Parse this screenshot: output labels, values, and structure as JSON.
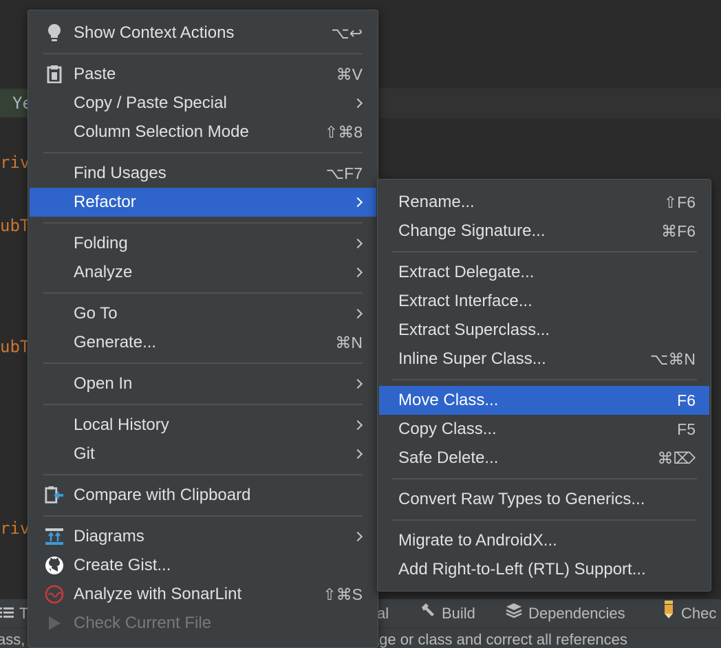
{
  "editor": {
    "code_fragments": [
      "Ye",
      "riv",
      "ubT",
      "ubT",
      "riv"
    ]
  },
  "toolbar": {
    "todo_fragment": "T",
    "terminal_fragment": "al",
    "build": "Build",
    "dependencies": "Dependencies",
    "check": "Chec"
  },
  "status": {
    "message": "ass, method, package or static member to another package or class and correct all references"
  },
  "context_menu": {
    "items": [
      {
        "label": "Show Context Actions",
        "shortcut": "⌥↩",
        "icon": "lightbulb-icon"
      },
      {
        "label": "Paste",
        "shortcut": "⌘V",
        "icon": "clipboard-icon"
      },
      {
        "label": "Copy / Paste Special",
        "submenu": true
      },
      {
        "label": "Column Selection Mode",
        "shortcut": "⇧⌘8"
      },
      {
        "label": "Find Usages",
        "shortcut": "⌥F7"
      },
      {
        "label": "Refactor",
        "submenu": true,
        "selected": true
      },
      {
        "label": "Folding",
        "submenu": true
      },
      {
        "label": "Analyze",
        "submenu": true
      },
      {
        "label": "Go To",
        "submenu": true
      },
      {
        "label": "Generate...",
        "shortcut": "⌘N"
      },
      {
        "label": "Open In",
        "submenu": true
      },
      {
        "label": "Local History",
        "submenu": true
      },
      {
        "label": "Git",
        "submenu": true
      },
      {
        "label": "Compare with Clipboard",
        "icon": "compare-clipboard-icon"
      },
      {
        "label": "Diagrams",
        "submenu": true,
        "icon": "diagram-icon"
      },
      {
        "label": "Create Gist...",
        "icon": "github-icon"
      },
      {
        "label": "Analyze with SonarLint",
        "shortcut": "⇧⌘S",
        "icon": "sonarlint-icon"
      },
      {
        "label": "Check Current File",
        "disabled": true,
        "icon": "play-icon"
      }
    ]
  },
  "refactor_submenu": {
    "items": [
      {
        "label": "Rename...",
        "shortcut": "⇧F6"
      },
      {
        "label": "Change Signature...",
        "shortcut": "⌘F6"
      },
      {
        "label": "Extract Delegate..."
      },
      {
        "label": "Extract Interface..."
      },
      {
        "label": "Extract Superclass..."
      },
      {
        "label": "Inline Super Class...",
        "shortcut": "⌥⌘N"
      },
      {
        "label": "Move Class...",
        "shortcut": "F6",
        "selected": true
      },
      {
        "label": "Copy Class...",
        "shortcut": "F5"
      },
      {
        "label": "Safe Delete...",
        "shortcut": "⌘⌦"
      },
      {
        "label": "Convert Raw Types to Generics..."
      },
      {
        "label": "Migrate to AndroidX..."
      },
      {
        "label": "Add Right-to-Left (RTL) Support..."
      }
    ]
  },
  "colors": {
    "menu_bg": "#3c3f41",
    "selection": "#2f65ca",
    "text": "#dfe1e5",
    "disabled_text": "#77797c"
  }
}
